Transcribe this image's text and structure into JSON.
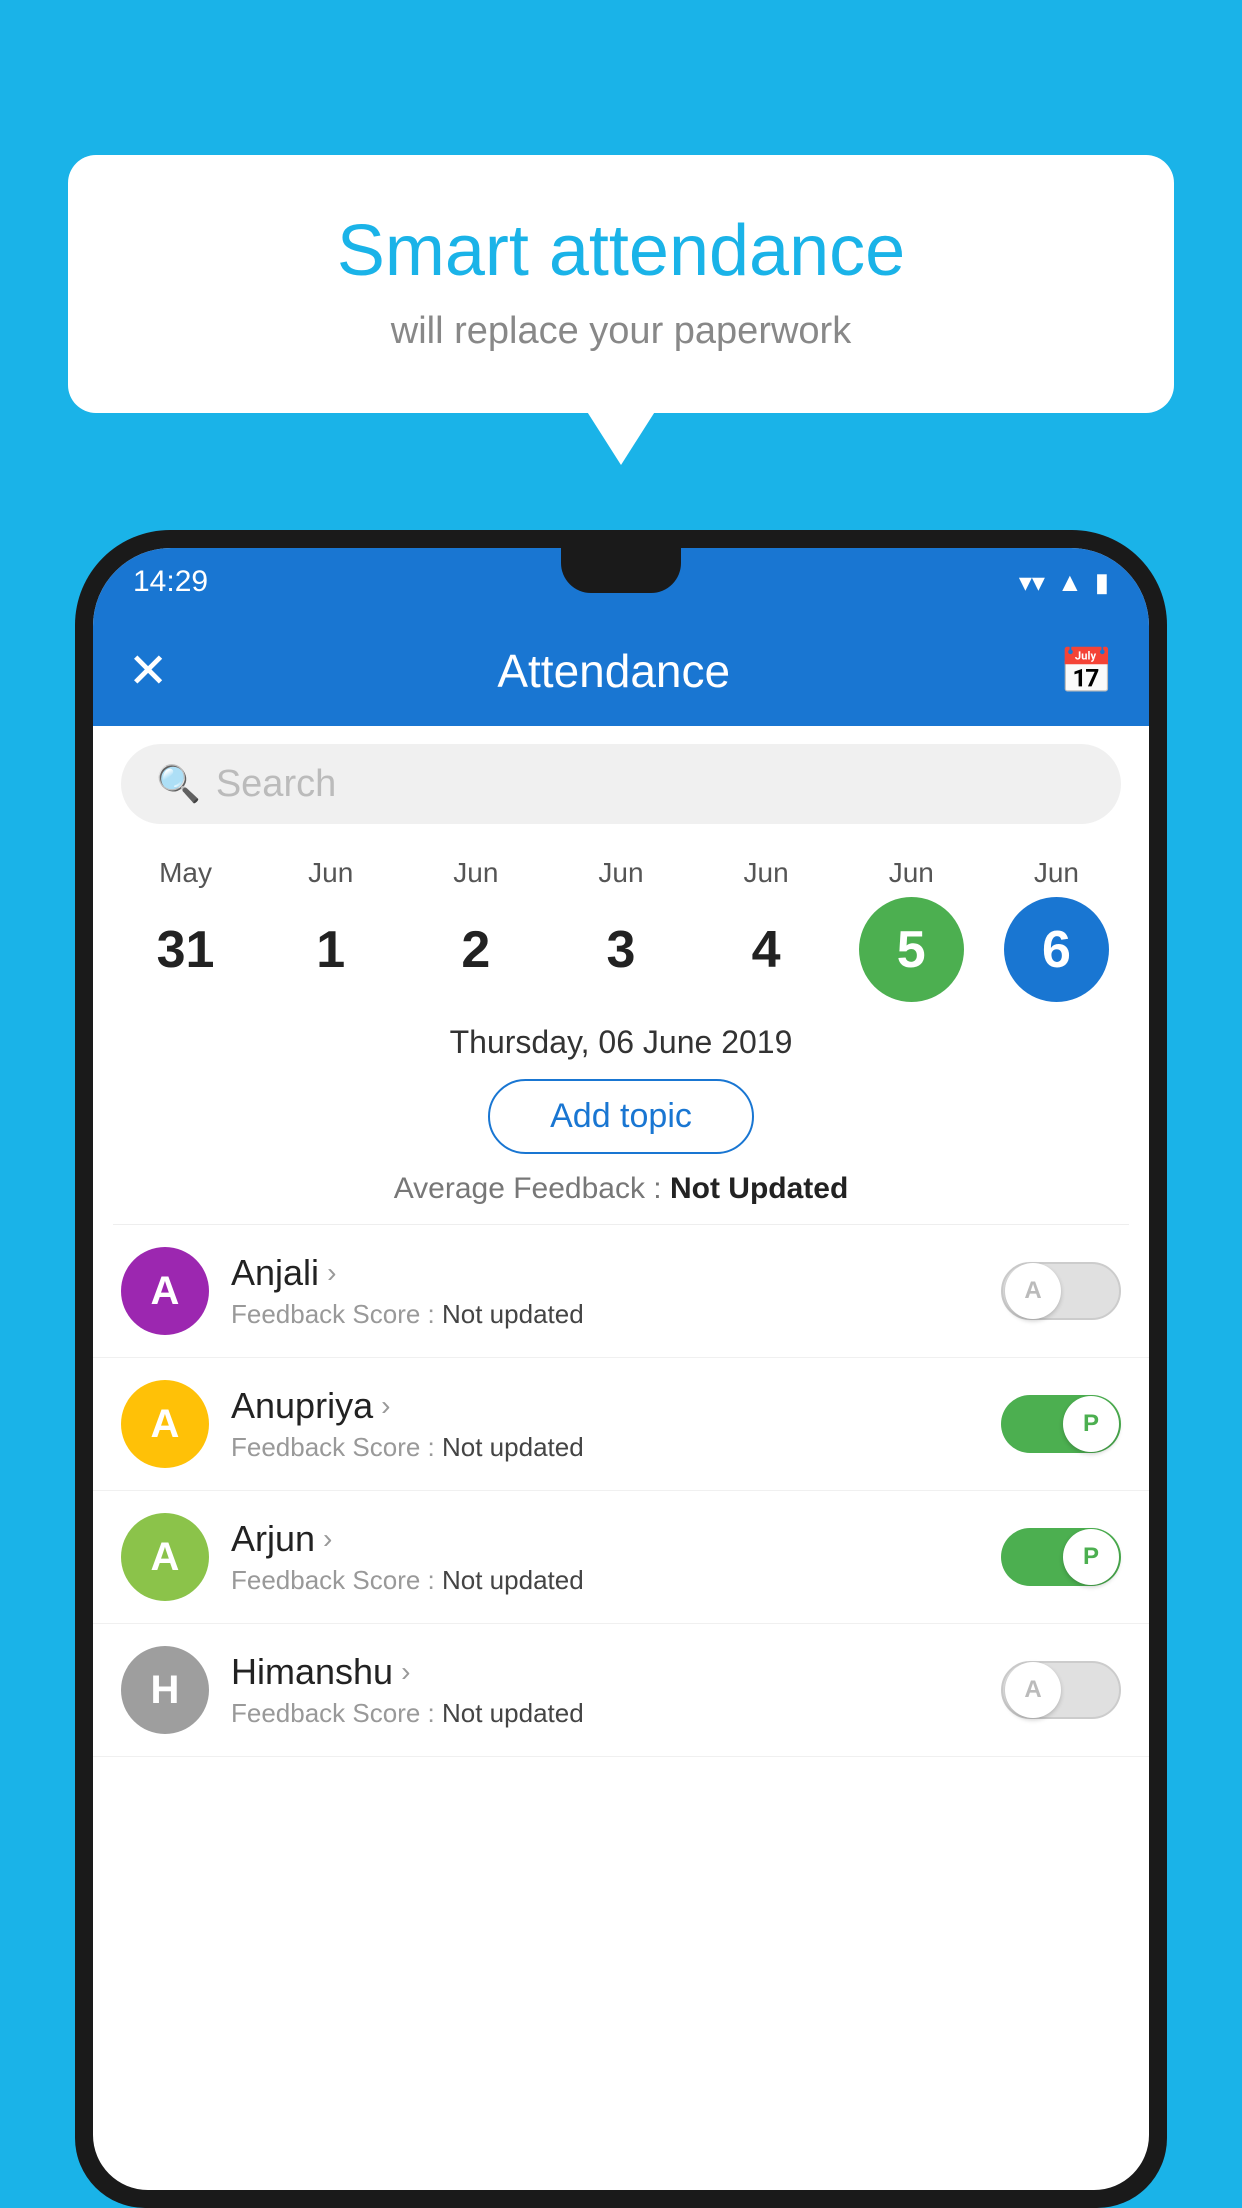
{
  "background": {
    "color": "#1ab3e8"
  },
  "bubble": {
    "title": "Smart attendance",
    "subtitle": "will replace your paperwork"
  },
  "status_bar": {
    "time": "14:29",
    "wifi": "▼",
    "signal": "▲",
    "battery": "▮"
  },
  "app_bar": {
    "title": "Attendance",
    "close_label": "✕",
    "calendar_label": "📅"
  },
  "search": {
    "placeholder": "Search"
  },
  "calendar": {
    "days": [
      {
        "month": "May",
        "date": "31",
        "state": "normal"
      },
      {
        "month": "Jun",
        "date": "1",
        "state": "normal"
      },
      {
        "month": "Jun",
        "date": "2",
        "state": "normal"
      },
      {
        "month": "Jun",
        "date": "3",
        "state": "normal"
      },
      {
        "month": "Jun",
        "date": "4",
        "state": "normal"
      },
      {
        "month": "Jun",
        "date": "5",
        "state": "today"
      },
      {
        "month": "Jun",
        "date": "6",
        "state": "selected"
      }
    ]
  },
  "selected_date": {
    "label": "Thursday, 06 June 2019"
  },
  "add_topic": {
    "label": "Add topic"
  },
  "feedback": {
    "label": "Average Feedback : ",
    "value": "Not Updated"
  },
  "students": [
    {
      "name": "Anjali",
      "avatar_letter": "A",
      "avatar_color": "#9c27b0",
      "feedback_label": "Feedback Score : ",
      "feedback_value": "Not updated",
      "attendance": "absent"
    },
    {
      "name": "Anupriya",
      "avatar_letter": "A",
      "avatar_color": "#ffc107",
      "feedback_label": "Feedback Score : ",
      "feedback_value": "Not updated",
      "attendance": "present"
    },
    {
      "name": "Arjun",
      "avatar_letter": "A",
      "avatar_color": "#8bc34a",
      "feedback_label": "Feedback Score : ",
      "feedback_value": "Not updated",
      "attendance": "present"
    },
    {
      "name": "Himanshu",
      "avatar_letter": "H",
      "avatar_color": "#9e9e9e",
      "feedback_label": "Feedback Score : ",
      "feedback_value": "Not updated",
      "attendance": "absent"
    }
  ]
}
